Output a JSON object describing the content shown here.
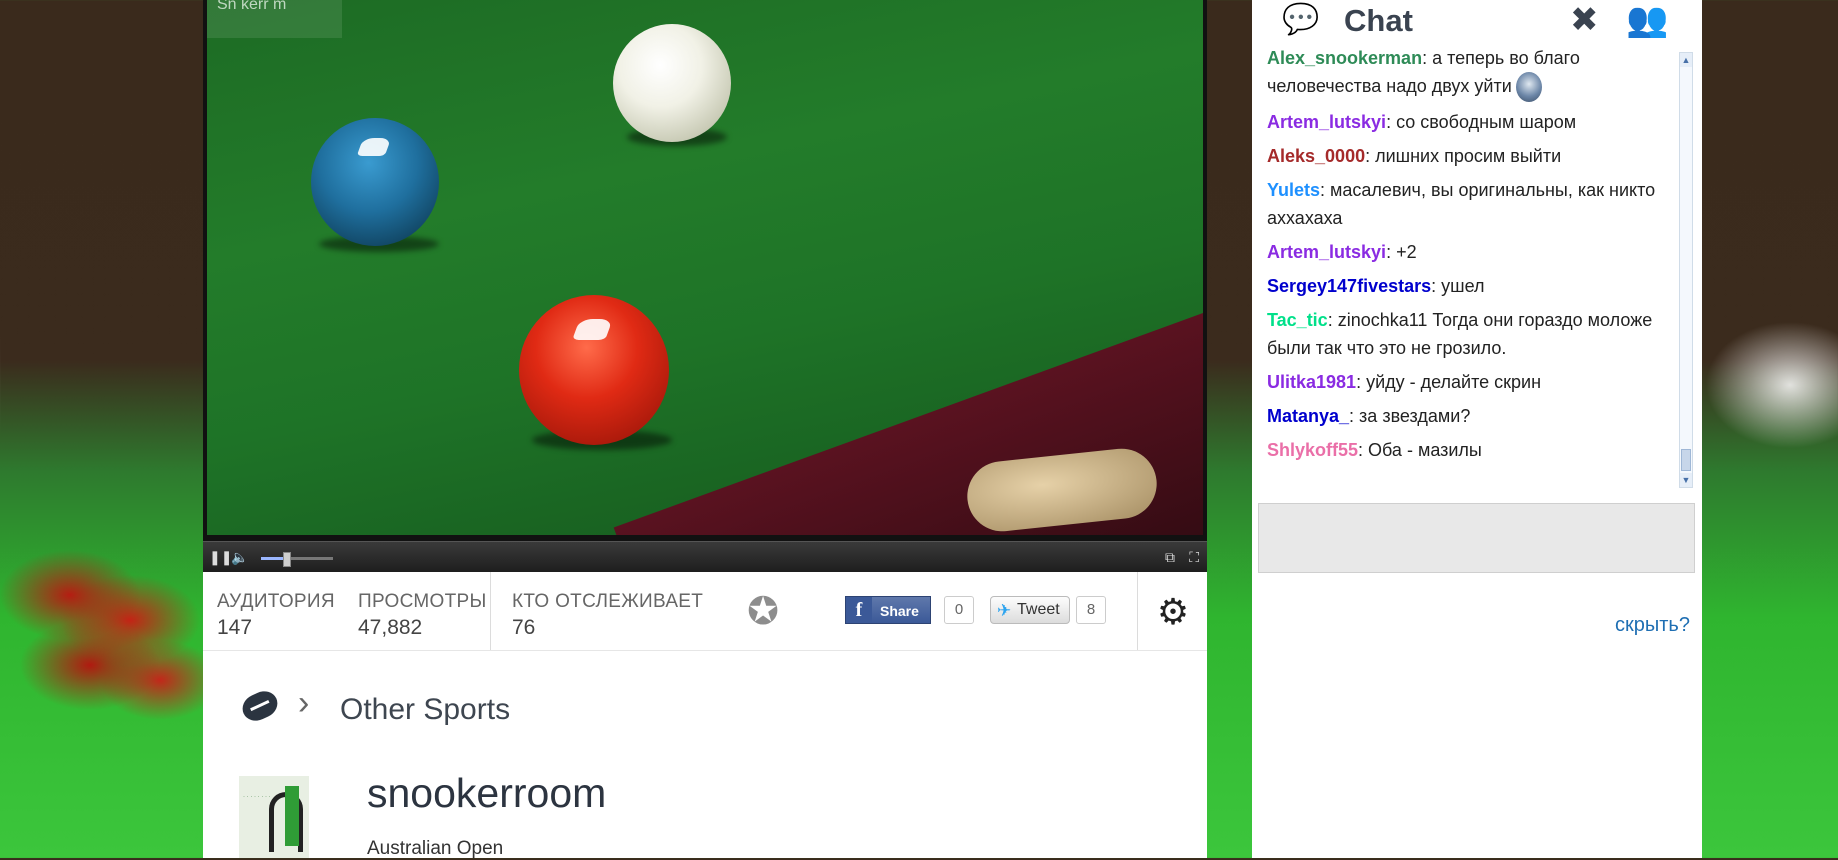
{
  "player": {
    "watermark": "Sn  kerr  m",
    "controls": {
      "pause_icon": "pause-icon",
      "volume_icon": "speaker-icon",
      "volume_level": 0.35,
      "popout_icon": "popout-icon",
      "fullscreen_icon": "fullscreen-icon"
    }
  },
  "stats": {
    "audience_label": "АУДИТОРИЯ",
    "audience_value": "147",
    "views_label": "ПРОСМОТРЫ",
    "views_value": "47,882",
    "followers_label": "КТО ОТСЛЕЖИВАЕТ",
    "followers_value": "76",
    "facebook": {
      "label": "Share",
      "count": "0"
    },
    "twitter": {
      "label": "Tweet",
      "count": "8"
    }
  },
  "info": {
    "category": "Other Sports",
    "channel_name": "snookerroom",
    "stream_title": "Australian Open"
  },
  "chat": {
    "title": "Chat",
    "hide_label": "скрыть?",
    "colors": {
      "green": "#2e8b57",
      "purple": "#8a2be2",
      "darkred": "#a52a2a",
      "dodgerblue": "#1e90ff",
      "blue": "#0000cd",
      "springgreen": "#00e08a",
      "pink": "#ea6fa8"
    },
    "messages": [
      {
        "user": "Alex_snookerman",
        "color": "#2e8b57",
        "text": ": а теперь во благо человечества надо двух уйти",
        "emoticon": true
      },
      {
        "user": "Artem_lutskyi",
        "color": "#8a2be2",
        "text": ": со свободным шаром"
      },
      {
        "user": "Aleks_0000",
        "color": "#a52a2a",
        "text": ": лишних просим выйти"
      },
      {
        "user": "Yulets",
        "color": "#1e90ff",
        "text": ": масалевич, вы оригинальны, как никто аххахаха"
      },
      {
        "user": "Artem_lutskyi",
        "color": "#8a2be2",
        "text": ": +2"
      },
      {
        "user": "Sergey147fivestars",
        "color": "#0000cd",
        "text": ": ушел"
      },
      {
        "user": "Tac_tic",
        "color": "#00e08a",
        "text": ": zinochka11 Тогда они гораздо моложе были так что это не грозило."
      },
      {
        "user": "Ulitka1981",
        "color": "#8a2be2",
        "text": ": уйду - делайте скрин"
      },
      {
        "user": "Matanya_",
        "color": "#0000cd",
        "text": ": за звездами?"
      },
      {
        "user": "Shlykoff55",
        "color": "#ea6fa8",
        "text": ": Оба - мазилы"
      }
    ]
  }
}
